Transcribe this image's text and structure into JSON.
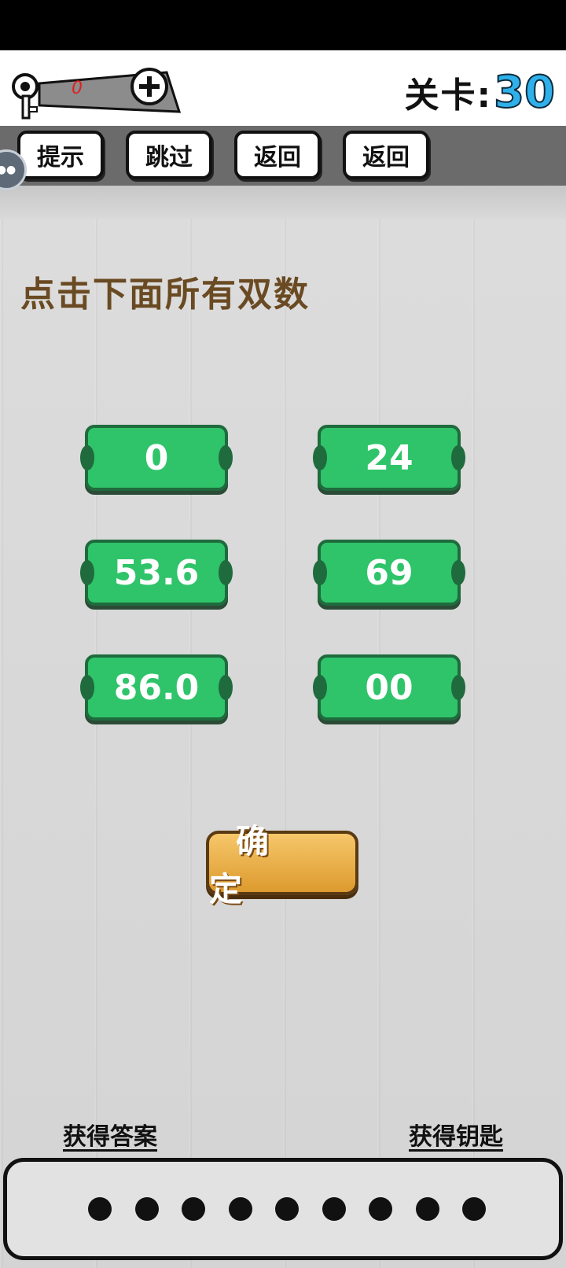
{
  "header": {
    "key_count": "0",
    "level_label": "关卡:",
    "level_number": "30"
  },
  "toolbar": {
    "hint_label": "提示",
    "skip_label": "跳过",
    "back_label_1": "返回",
    "back_label_2": "返回"
  },
  "question": {
    "text": "点击下面所有双数"
  },
  "options": [
    "0",
    "24",
    "53.6",
    "69",
    "86.0",
    "00"
  ],
  "confirm_label": "确　定",
  "bottom": {
    "get_answer_label": "获得答案",
    "get_key_label": "获得钥匙",
    "answer_slots": 9
  },
  "colors": {
    "option_green": "#2fc46a",
    "level_blue": "#2fb0ea",
    "question_brown": "#6a4a22",
    "confirm_gold": "#dd9a2e"
  }
}
